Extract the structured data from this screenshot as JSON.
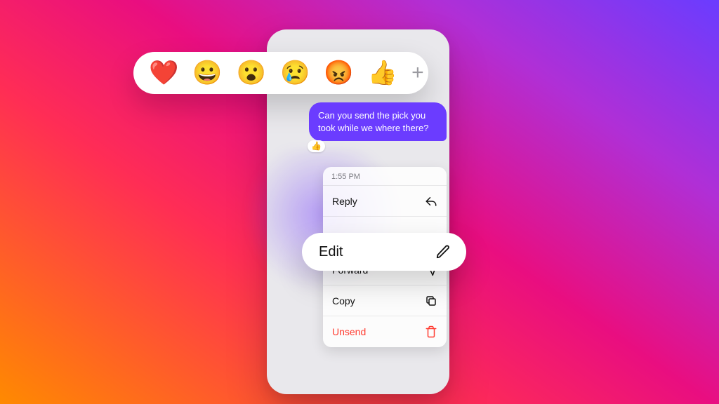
{
  "reactions": {
    "items": [
      "❤️",
      "😀",
      "😮",
      "😢",
      "😡",
      "👍"
    ],
    "add_glyph": "+"
  },
  "message": {
    "text": "Can you send the pick you took while we where there?",
    "reaction_glyph": "👍"
  },
  "context_menu": {
    "timestamp": "1:55 PM",
    "reply": {
      "label": "Reply",
      "icon": "reply-icon"
    },
    "edit": {
      "label": "Edit",
      "icon": "pencil-icon"
    },
    "forward": {
      "label": "Forward",
      "icon": "forward-icon"
    },
    "copy": {
      "label": "Copy",
      "icon": "copy-icon"
    },
    "unsend": {
      "label": "Unsend",
      "icon": "trash-icon"
    }
  },
  "colors": {
    "bubble": "#6b3cff",
    "danger": "#ff3b30"
  }
}
